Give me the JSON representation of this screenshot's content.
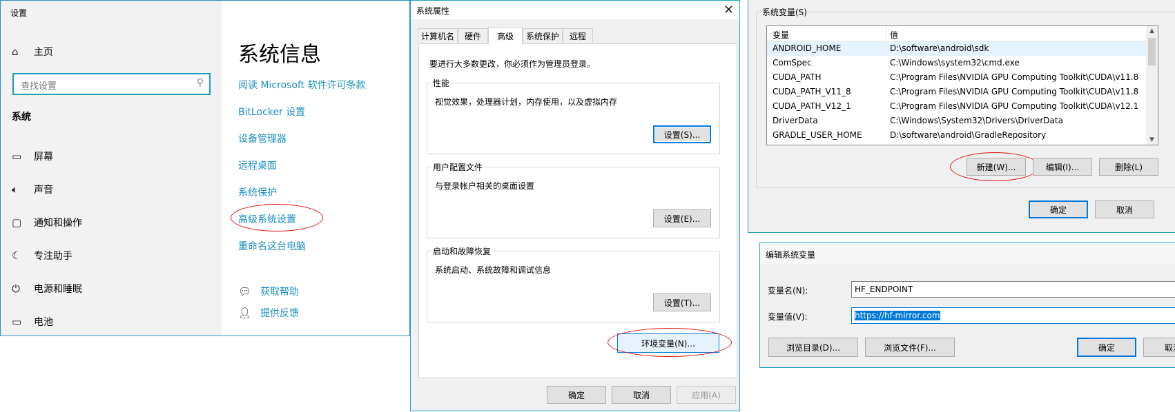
{
  "settings": {
    "title": "设置",
    "home": "主页",
    "search_placeholder": "查找设置",
    "section": "系统",
    "nav": [
      "屏幕",
      "声音",
      "通知和操作",
      "专注助手",
      "电源和睡眠",
      "电池"
    ],
    "page_title": "系统信息",
    "links": [
      "阅读 Microsoft 软件许可条款",
      "BitLocker 设置",
      "设备管理器",
      "远程桌面",
      "系统保护",
      "高级系统设置",
      "重命名这台电脑"
    ],
    "help": [
      "获取帮助",
      "提供反馈"
    ]
  },
  "sysprops": {
    "title": "系统属性",
    "close": "×",
    "tabs": [
      "计算机名",
      "硬件",
      "高级",
      "系统保护",
      "远程"
    ],
    "admin_note": "要进行大多数更改，你必须作为管理员登录。",
    "perf": {
      "legend": "性能",
      "desc": "视觉效果，处理器计划，内存使用，以及虚拟内存",
      "button": "设置(S)..."
    },
    "profile": {
      "legend": "用户配置文件",
      "desc": "与登录帐户相关的桌面设置",
      "button": "设置(E)..."
    },
    "startup": {
      "legend": "启动和故障恢复",
      "desc": "系统启动、系统故障和调试信息",
      "button": "设置(T)..."
    },
    "env_button": "环境变量(N)...",
    "ok": "确定",
    "cancel": "取消",
    "apply": "应用(A)"
  },
  "envvars": {
    "group_label": "系统变量(S)",
    "col_var": "变量",
    "col_val": "值",
    "rows": [
      {
        "name": "ANDROID_HOME",
        "value": "D:\\software\\android\\sdk"
      },
      {
        "name": "ComSpec",
        "value": "C:\\Windows\\system32\\cmd.exe"
      },
      {
        "name": "CUDA_PATH",
        "value": "C:\\Program Files\\NVIDIA GPU Computing Toolkit\\CUDA\\v11.8"
      },
      {
        "name": "CUDA_PATH_V11_8",
        "value": "C:\\Program Files\\NVIDIA GPU Computing Toolkit\\CUDA\\v11.8"
      },
      {
        "name": "CUDA_PATH_V12_1",
        "value": "C:\\Program Files\\NVIDIA GPU Computing Toolkit\\CUDA\\v12.1"
      },
      {
        "name": "DriverData",
        "value": "C:\\Windows\\System32\\Drivers\\DriverData"
      },
      {
        "name": "GRADLE_USER_HOME",
        "value": "D:\\software\\android\\GradleRepository"
      }
    ],
    "new_button": "新建(W)...",
    "edit_button": "编辑(I)...",
    "delete_button": "删除(L)",
    "ok": "确定",
    "cancel": "取消"
  },
  "editvar": {
    "title": "编辑系统变量",
    "name_label": "变量名(N):",
    "name_value": "HF_ENDPOINT",
    "value_label": "变量值(V):",
    "value_value": "https://hf-mirror.com",
    "browse_dir": "浏览目录(D)...",
    "browse_file": "浏览文件(F)...",
    "ok": "确定",
    "cancel": "取消"
  }
}
